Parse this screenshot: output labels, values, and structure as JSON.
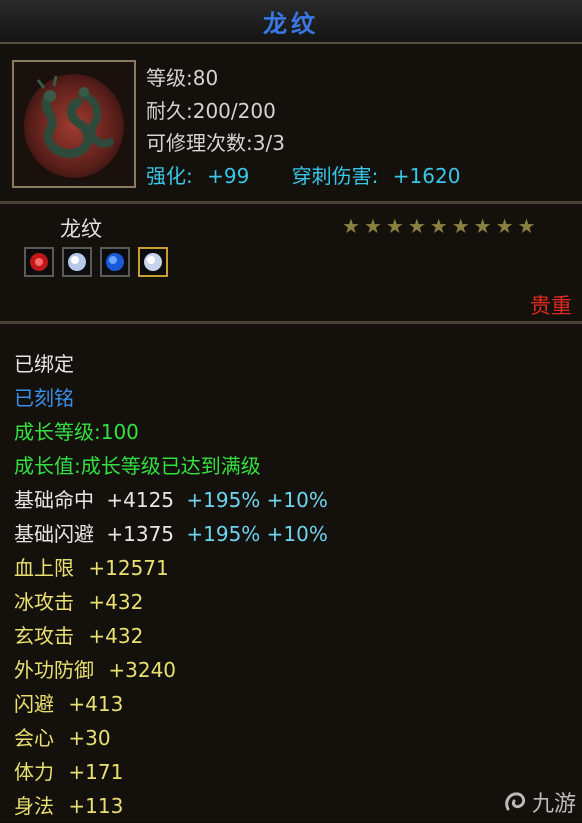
{
  "item": {
    "title": "龙纹",
    "name": "龙纹",
    "quality": "贵重",
    "stats": {
      "level": "等级:80",
      "durability": "耐久:200/200",
      "repair": "可修理次数:3/3"
    },
    "enhance": {
      "label": "强化:",
      "value": "+99"
    },
    "pierce": {
      "label": "穿刺伤害:",
      "value": "+1620"
    },
    "stars": {
      "count": 9
    },
    "gems": [
      "red-gem-icon",
      "white-gem-icon",
      "blue-gem-icon",
      "white-gem-icon"
    ]
  },
  "attrs": {
    "bound": "已绑定",
    "engraved": "已刻铭",
    "growth_level": "成长等级:100",
    "growth_value": "成长值:成长等级已达到满级",
    "hit": {
      "label": "基础命中",
      "value": "+4125",
      "bonus": "+195% +10%"
    },
    "dodge_base": {
      "label": "基础闪避",
      "value": "+1375",
      "bonus": "+195% +10%"
    },
    "hp": {
      "label": "血上限",
      "value": "+12571"
    },
    "ice": {
      "label": "冰攻击",
      "value": "+432"
    },
    "xuan": {
      "label": "玄攻击",
      "value": "+432"
    },
    "defense": {
      "label": "外功防御",
      "value": "+3240"
    },
    "dodge": {
      "label": "闪避",
      "value": "+413"
    },
    "crit": {
      "label": "会心",
      "value": "+30"
    },
    "stamina": {
      "label": "体力",
      "value": "+171"
    },
    "agility": {
      "label": "身法",
      "value": "+113"
    }
  },
  "watermark": "九游",
  "colors": {
    "title": "#3a78e8",
    "quality": "#e02a20",
    "growth": "#33e040",
    "engraved": "#3a8fe8",
    "bonus": "#6fd4f0",
    "values": "#e8e070"
  }
}
